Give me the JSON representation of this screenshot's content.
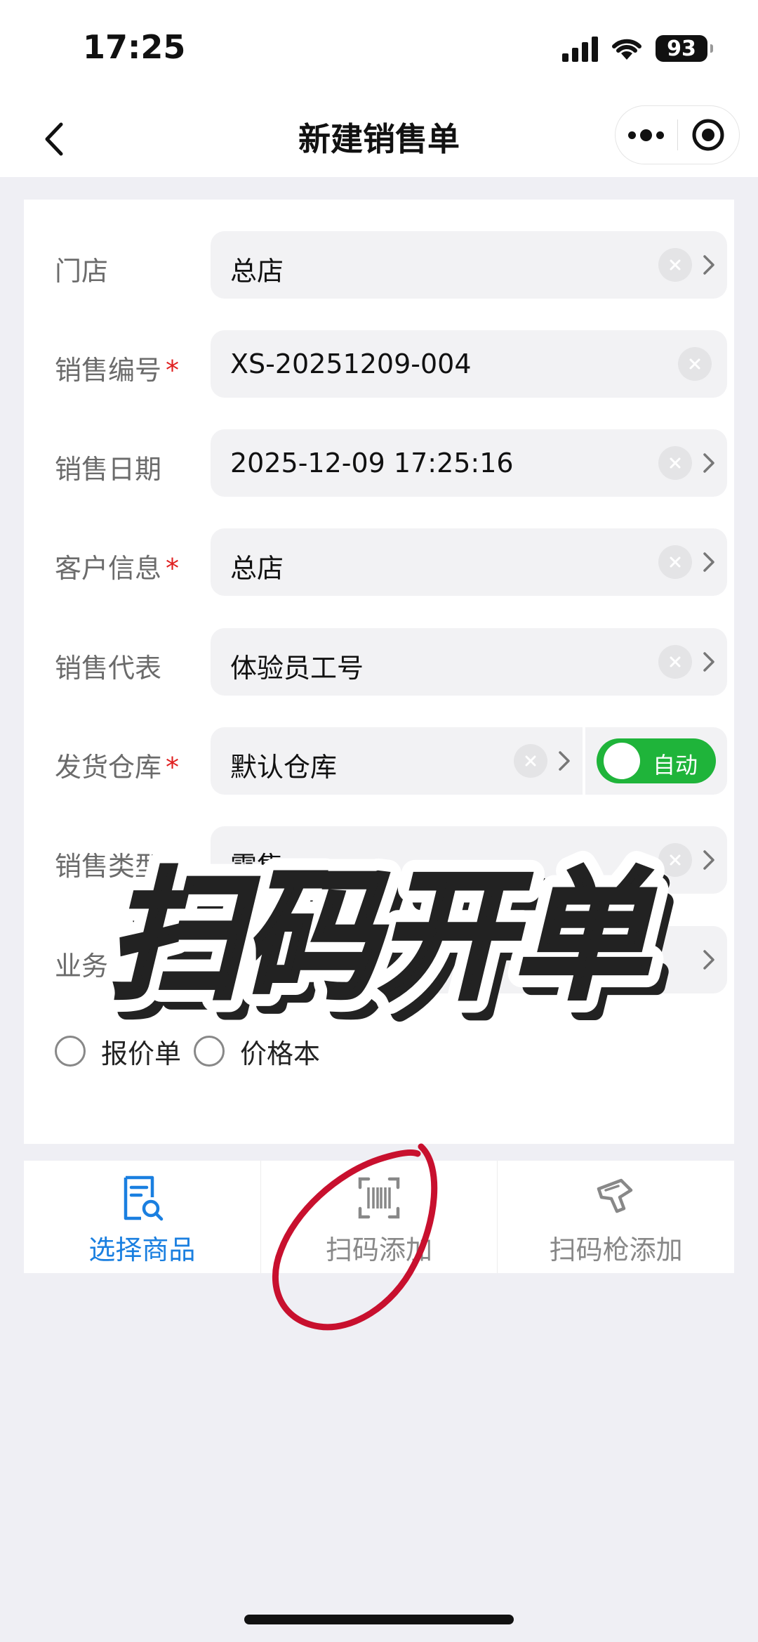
{
  "status_bar": {
    "time": "17:25",
    "battery": "93"
  },
  "nav": {
    "title": "新建销售单"
  },
  "form": {
    "store": {
      "label": "门店",
      "value": "总店"
    },
    "sales_no": {
      "label": "销售编号",
      "value": "XS-20251209-004"
    },
    "sales_date": {
      "label": "销售日期",
      "value": "2025-12-09 17:25:16"
    },
    "customer": {
      "label": "客户信息",
      "value": "总店"
    },
    "rep": {
      "label": "销售代表",
      "value": "体验员工号"
    },
    "warehouse": {
      "label": "发货仓库",
      "value": "默认仓库",
      "toggle_label": "自动",
      "toggle_on": true
    },
    "sales_type": {
      "label": "销售类型",
      "value": "零售"
    },
    "business": {
      "label": "业务"
    },
    "required_mark": "*"
  },
  "options": {
    "quote": "报价单",
    "price_book": "价格本"
  },
  "actions": {
    "select_goods": "选择商品",
    "scan_add": "扫码添加",
    "scanner_add": "扫码枪添加"
  },
  "overlay": {
    "stamp_text": "扫码开单"
  },
  "colors": {
    "accent_blue": "#1a7fe0",
    "toggle_green": "#1fb43a",
    "required_red": "#e02020",
    "stamp_yellow": "#f5c518"
  }
}
